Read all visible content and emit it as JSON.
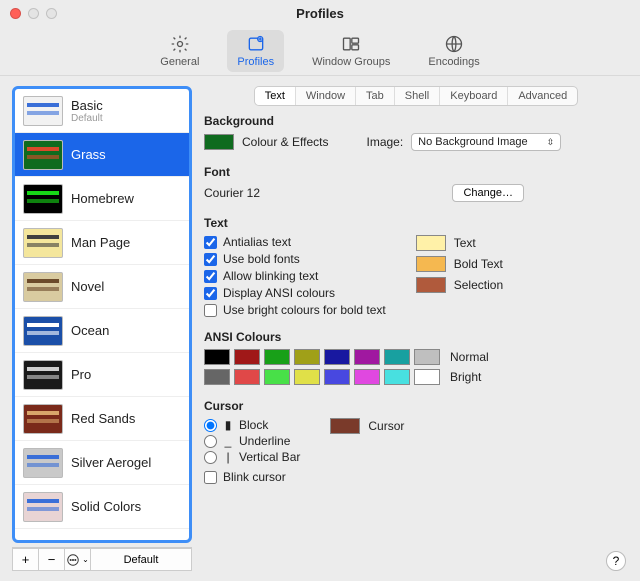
{
  "window": {
    "title": "Profiles"
  },
  "toolbar": {
    "items": [
      {
        "label": "General"
      },
      {
        "label": "Profiles"
      },
      {
        "label": "Window Groups"
      },
      {
        "label": "Encodings"
      }
    ],
    "selected": 1
  },
  "sidebar": {
    "profiles": [
      {
        "name": "Basic",
        "subtitle": "Default",
        "bg": "#f2f2f2",
        "acc": "#3a6fd8"
      },
      {
        "name": "Grass",
        "bg": "#0f6b1f",
        "acc": "#d94a2a"
      },
      {
        "name": "Homebrew",
        "bg": "#000000",
        "acc": "#17d817"
      },
      {
        "name": "Man Page",
        "bg": "#f4e69c",
        "acc": "#404040"
      },
      {
        "name": "Novel",
        "bg": "#d9cba0",
        "acc": "#6b4a2a"
      },
      {
        "name": "Ocean",
        "bg": "#1b4fa8",
        "acc": "#ffffff"
      },
      {
        "name": "Pro",
        "bg": "#1a1a1a",
        "acc": "#cfcfcf"
      },
      {
        "name": "Red Sands",
        "bg": "#7a2a1a",
        "acc": "#d9a66b"
      },
      {
        "name": "Silver Aerogel",
        "bg": "#c9c9c9",
        "acc": "#3a6fd8"
      },
      {
        "name": "Solid Colors",
        "bg": "#e8d4d4",
        "acc": "#3a6fd8"
      }
    ],
    "selected": 1,
    "footer": {
      "add": "+",
      "remove": "−",
      "menu": "⊙⌄",
      "default_btn": "Default"
    }
  },
  "tabs": {
    "items": [
      "Text",
      "Window",
      "Tab",
      "Shell",
      "Keyboard",
      "Advanced"
    ],
    "selected": 0
  },
  "background": {
    "heading": "Background",
    "swatch": "#0f6b1f",
    "swatch_label": "Colour & Effects",
    "image_label": "Image:",
    "image_select": "No Background Image"
  },
  "font": {
    "heading": "Font",
    "value": "Courier 12",
    "change_btn": "Change…"
  },
  "text": {
    "heading": "Text",
    "checks": {
      "antialias": {
        "label": "Antialias text",
        "checked": true
      },
      "bold": {
        "label": "Use bold fonts",
        "checked": true
      },
      "blink": {
        "label": "Allow blinking text",
        "checked": true
      },
      "ansi": {
        "label": "Display ANSI colours",
        "checked": true
      },
      "bright_bold": {
        "label": "Use bright colours for bold text",
        "checked": false
      }
    },
    "swatches": {
      "text": {
        "label": "Text",
        "color": "#fff1a8"
      },
      "bold_text": {
        "label": "Bold Text",
        "color": "#f5b850"
      },
      "selection": {
        "label": "Selection",
        "color": "#b05a3c"
      }
    }
  },
  "ansi": {
    "heading": "ANSI Colours",
    "normal_label": "Normal",
    "bright_label": "Bright",
    "normal": [
      "#000000",
      "#a01818",
      "#18a018",
      "#a0a018",
      "#1818a0",
      "#a018a0",
      "#18a0a0",
      "#bfbfbf"
    ],
    "bright": [
      "#666666",
      "#e04848",
      "#48e048",
      "#e0e048",
      "#4848e0",
      "#e048e0",
      "#48e0e0",
      "#ffffff"
    ]
  },
  "cursor": {
    "heading": "Cursor",
    "selected": "block",
    "options": {
      "block": "Block",
      "underline": "Underline",
      "vbar": "Vertical Bar"
    },
    "blink": {
      "label": "Blink cursor",
      "checked": false
    },
    "swatch_label": "Cursor",
    "swatch": "#7a3a2a"
  },
  "help": "?"
}
